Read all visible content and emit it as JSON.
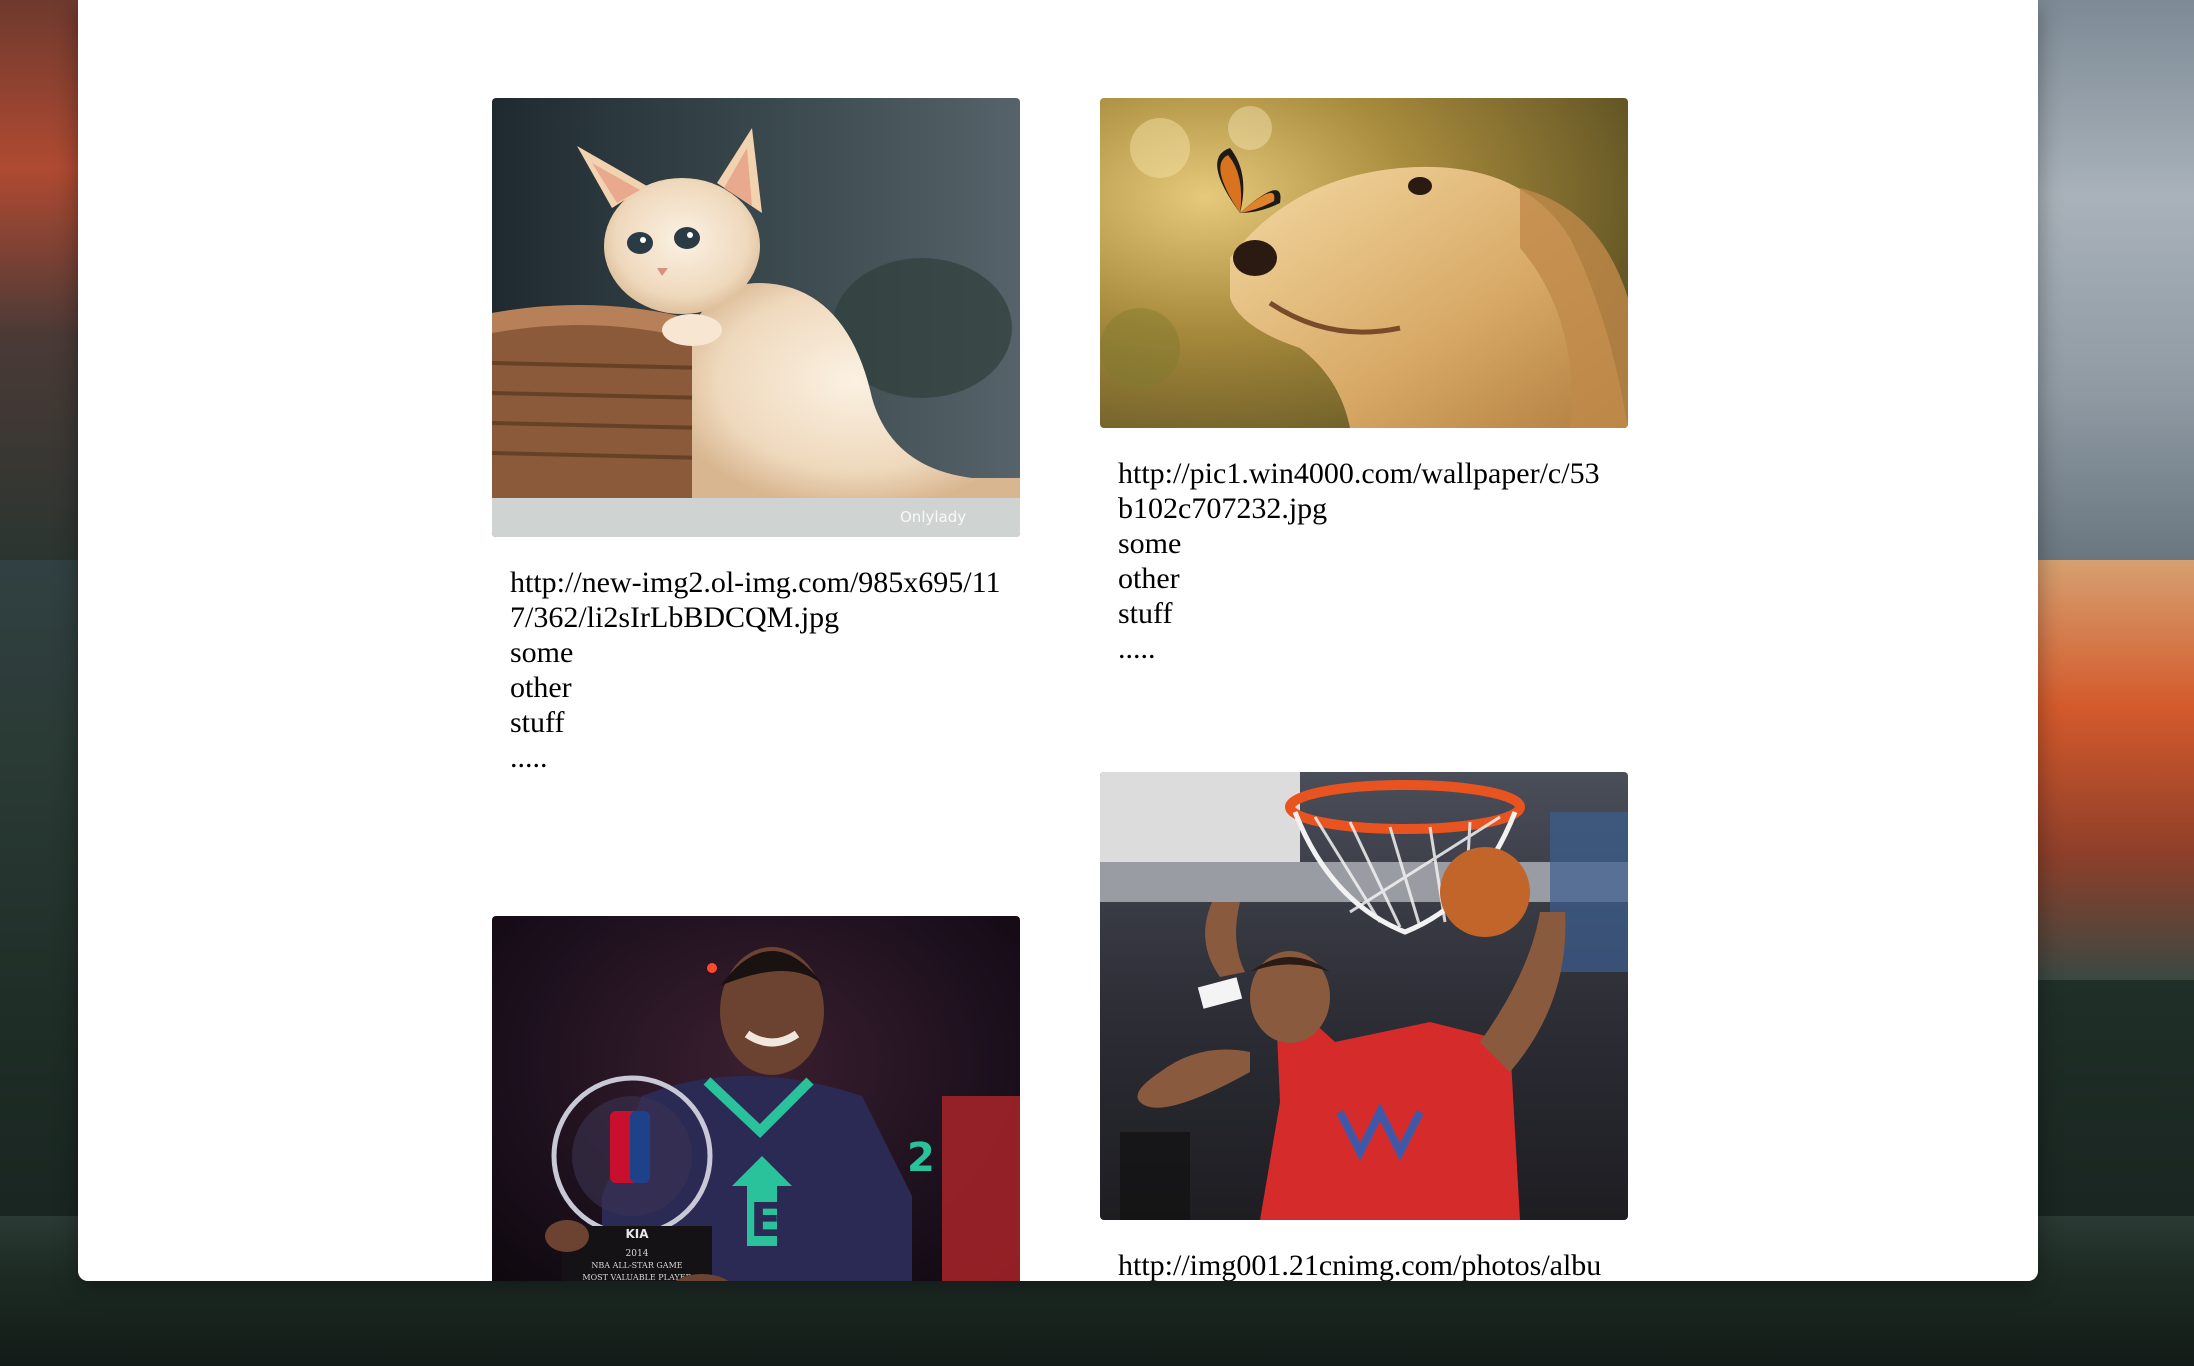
{
  "cards": [
    {
      "image_subject": "kitten in basket",
      "watermark": "Onlylady",
      "url": "http://new-img2.ol-img.com/985x695/117/362/li2sIrLbBDCQM.jpg",
      "lines": [
        "some",
        "other",
        "stuff",
        "....."
      ]
    },
    {
      "image_subject": "golden retriever with butterfly",
      "url": "http://pic1.win4000.com/wallpaper/c/53b102c707232.jpg",
      "lines": [
        "some",
        "other",
        "stuff",
        "....."
      ]
    },
    {
      "image_subject": "basketball player with trophy",
      "trophy_plate": {
        "brand": "KIA",
        "year": "2014",
        "event": "NBA ALL-STAR GAME",
        "award": "MOST VALUABLE PLAYER"
      },
      "jersey_letter": "E",
      "jersey_number": "2"
    },
    {
      "image_subject": "basketball player dunking",
      "url": "http://img001.21cnimg.com/photos/albu"
    }
  ]
}
